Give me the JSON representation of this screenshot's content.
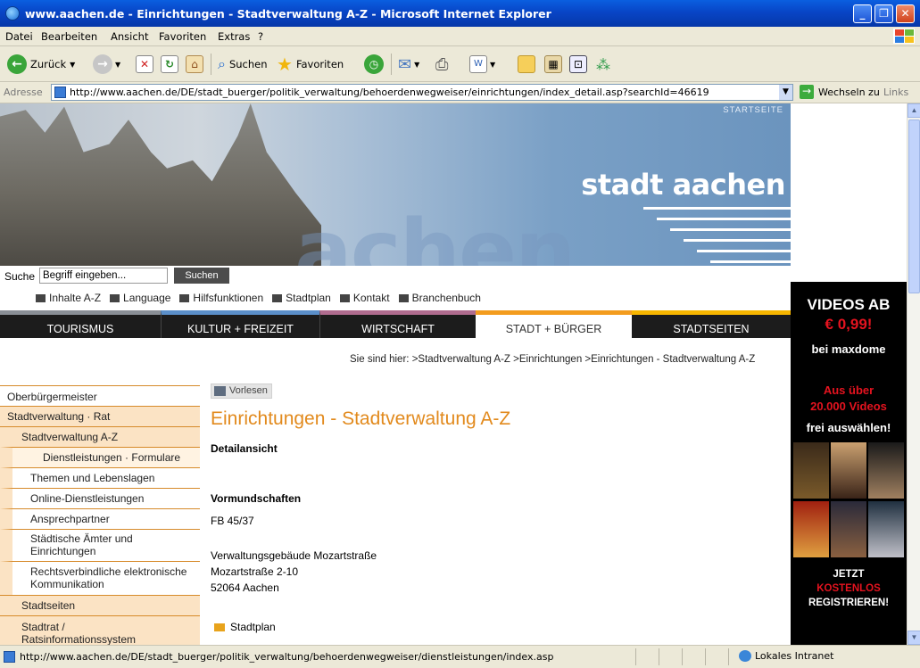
{
  "window": {
    "title": "www.aachen.de - Einrichtungen - Stadtverwaltung A-Z - Microsoft Internet Explorer"
  },
  "menu": [
    "Datei",
    "Bearbeiten",
    "Ansicht",
    "Favoriten",
    "Extras",
    "?"
  ],
  "toolbar": {
    "back_label": "Zurück",
    "search_label": "Suchen",
    "favorites_label": "Favoriten"
  },
  "address": {
    "label": "Adresse",
    "url": "http://www.aachen.de/DE/stadt_buerger/politik_verwaltung/behoerdenwegweiser/einrichtungen/index_detail.asp?searchId=46619",
    "go_label": "Wechseln zu",
    "links_label": "Links"
  },
  "header": {
    "startseite": "STARTSEITE",
    "logo": "stadt aachen",
    "watermark": "achen"
  },
  "search": {
    "label": "Suche",
    "placeholder": "Begriff eingeben...",
    "button": "Suchen"
  },
  "quicklinks": [
    "Inhalte A-Z",
    "Language",
    "Hilfsfunktionen",
    "Stadtplan",
    "Kontakt",
    "Branchenbuch"
  ],
  "nav_tabs": [
    {
      "label": "TOURISMUS",
      "color": "#8a8f96"
    },
    {
      "label": "KULTUR + FREIZEIT",
      "color": "#5b8fc9"
    },
    {
      "label": "WIRTSCHAFT",
      "color": "#b06c8f"
    },
    {
      "label": "STADT + BÜRGER",
      "color": "#f39c1e"
    },
    {
      "label": "STADTSEITEN",
      "color": "#f7b600"
    }
  ],
  "breadcrumb": {
    "prefix": "Sie sind hier:",
    "items": [
      "Stadtverwaltung A-Z",
      "Einrichtungen",
      "Einrichtungen - Stadtverwaltung A-Z"
    ]
  },
  "leftnav": [
    "Oberbürgermeister",
    "Stadtverwaltung · Rat",
    "Stadtverwaltung A-Z",
    "Dienstleistungen · Formulare",
    "Themen und Lebenslagen",
    "Online-Dienstleistungen",
    "Ansprechpartner",
    "Städtische Ämter und Einrichtungen",
    "Rechtsverbindliche elektronische Kommunikation",
    "Stadtseiten",
    "Stadtrat / Ratsinformationssystem"
  ],
  "content": {
    "vorlesen": "Vorlesen",
    "title": "Einrichtungen - Stadtverwaltung A-Z",
    "detail": "Detailansicht",
    "section": "Vormundschaften",
    "fb": "FB 45/37",
    "address_lines": [
      "Verwaltungsgebäude Mozartstraße",
      "Mozartstraße 2-10",
      "52064 Aachen"
    ],
    "stadtplan": "Stadtplan"
  },
  "ad": {
    "line1": "VIDEOS AB",
    "line2": "€ 0,99!",
    "line3": "bei maxdome",
    "line4": "Aus über",
    "line5": "20.000 Videos",
    "line6": "frei auswählen!",
    "line7": "JETZT",
    "line8": "KOSTENLOS",
    "line9": "REGISTRIEREN!"
  },
  "status": {
    "url": "http://www.aachen.de/DE/stadt_buerger/politik_verwaltung/behoerdenwegweiser/dienstleistungen/index.asp",
    "zone": "Lokales Intranet"
  },
  "colors": {
    "accent_orange": "#e28a1d",
    "nav_dark": "#1c1c1c",
    "ad_red": "#e4131f"
  }
}
